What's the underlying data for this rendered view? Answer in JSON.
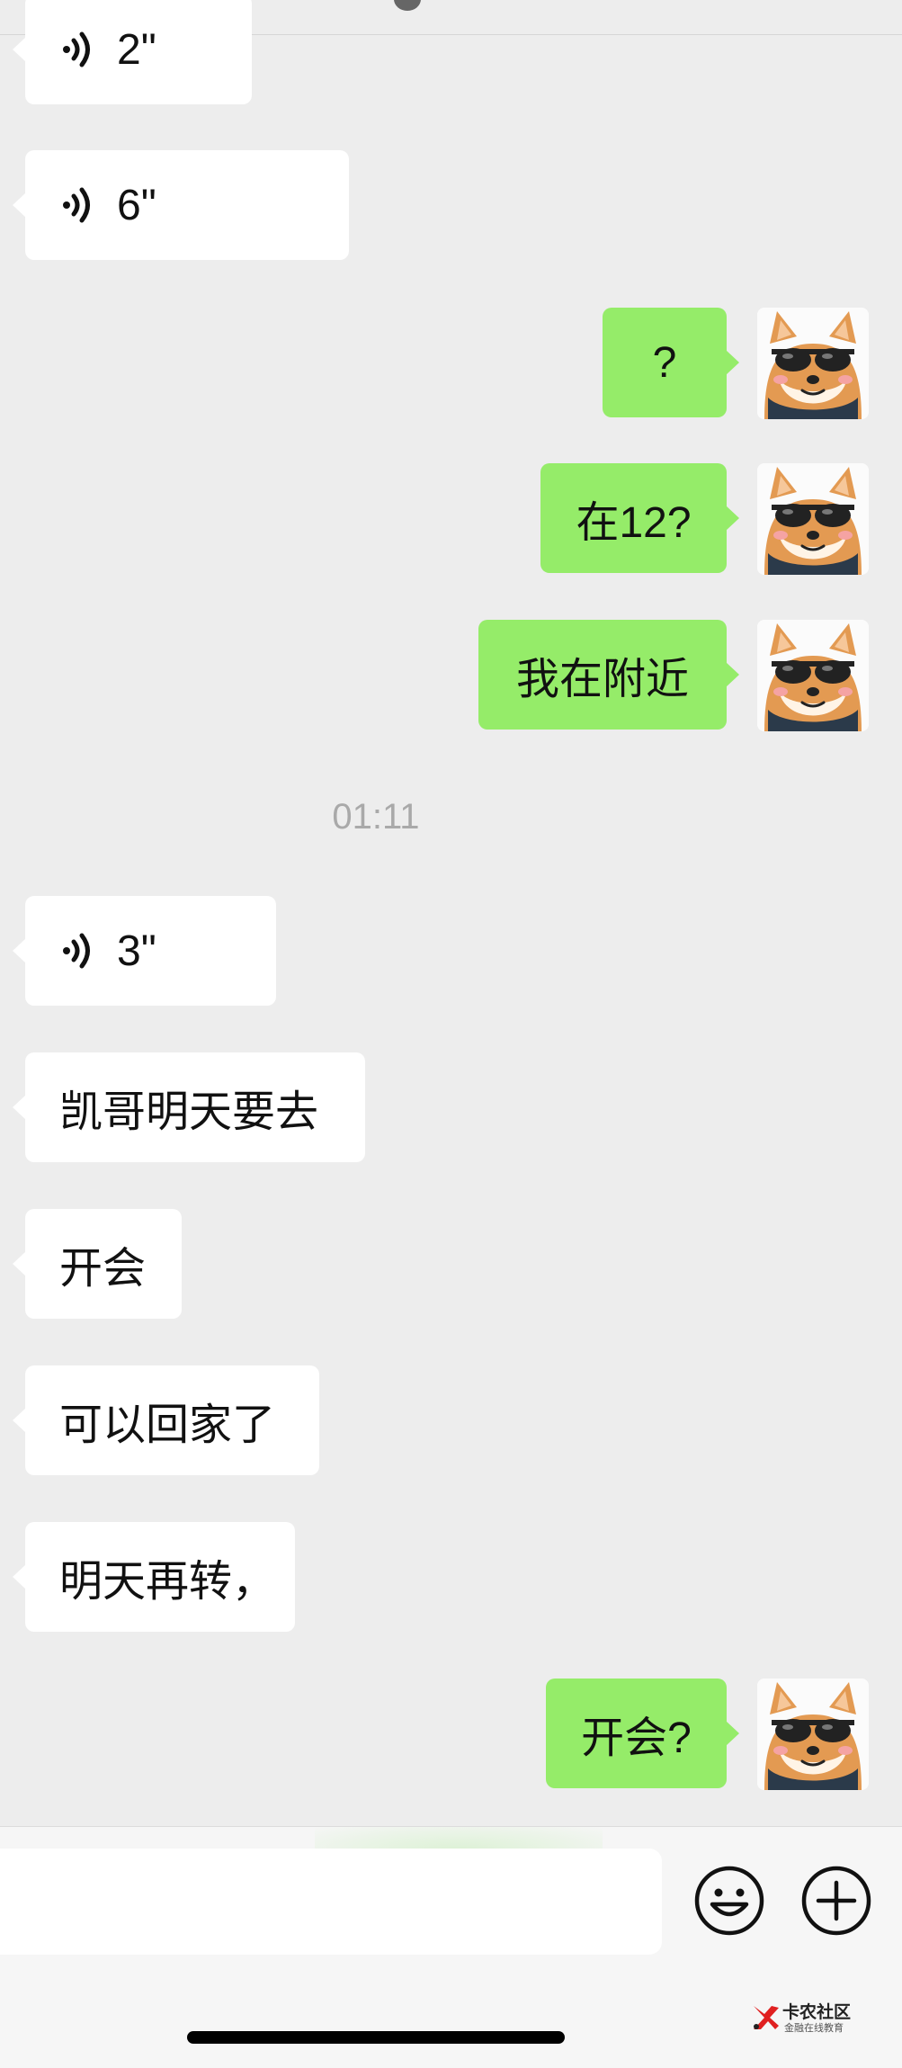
{
  "chat": {
    "messages": [
      {
        "side": "left",
        "type": "voice",
        "duration": "2\""
      },
      {
        "side": "left",
        "type": "voice",
        "duration": "6\""
      },
      {
        "side": "right",
        "type": "text",
        "text": "?"
      },
      {
        "side": "right",
        "type": "text",
        "text": "在12?"
      },
      {
        "side": "right",
        "type": "text",
        "text": "我在附近"
      },
      {
        "side": "left",
        "type": "voice",
        "duration": "3\""
      },
      {
        "side": "left",
        "type": "text",
        "text": "凯哥明天要去"
      },
      {
        "side": "left",
        "type": "text",
        "text": "开会"
      },
      {
        "side": "left",
        "type": "text",
        "text": "可以回家了"
      },
      {
        "side": "left",
        "type": "text",
        "text": "明天再转，"
      },
      {
        "side": "right",
        "type": "text",
        "text": "开会?"
      }
    ],
    "timestamp": "01:11"
  },
  "input_bar": {
    "icons": [
      "emoji-icon",
      "plus-icon"
    ]
  },
  "watermark": {
    "title": "卡农社区",
    "subtitle": "金融在线教育"
  },
  "colors": {
    "background": "#ededed",
    "right_bubble": "#95ec69",
    "left_bubble": "#ffffff"
  }
}
